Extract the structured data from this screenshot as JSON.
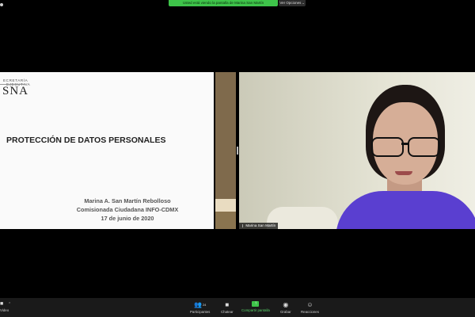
{
  "banner": {
    "share_text": "Usted está viendo la pantalla de Marina San Martín",
    "options_label": "Ver Opciones",
    "options_chevron": "⌄"
  },
  "slide": {
    "logo_line1": "ECRETARÍA",
    "logo_line2": "EJECUTIVA",
    "logo_sna": "SNA",
    "title": "PROTECCIÓN DE DATOS PERSONALES",
    "author_name": "Marina A. San Martín Rebolloso",
    "author_role": "Comisionada Ciudadana INFO-CDMX",
    "author_date": "17 de junio de 2020"
  },
  "video": {
    "participant_name": "Marina San Martín"
  },
  "toolbar": {
    "video_label": "Video",
    "participants_label": "Participantes",
    "participants_count": "24",
    "chat_label": "Chatear",
    "share_label": "Compartir pantalla",
    "record_label": "Grabar",
    "reactions_label": "Reacciones"
  },
  "colors": {
    "share_green": "#3ec44a",
    "shirt_purple": "#5a3fd0",
    "slide_bg": "#fafafa",
    "toolbar_bg": "#1a1a1a"
  }
}
